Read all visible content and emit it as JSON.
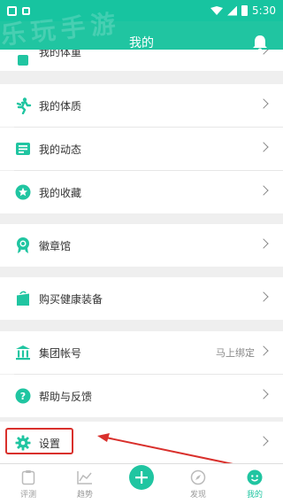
{
  "status_bar": {
    "time": "5:30"
  },
  "header": {
    "title": "我的",
    "watermark": "乐玩手游"
  },
  "menu": {
    "partial_item": "我的体重",
    "physique": "我的体质",
    "posts": "我的动态",
    "favorites": "我的收藏",
    "badges": "徽章馆",
    "buy_gear": "购买健康装备",
    "group_account": "集团帐号",
    "group_account_value": "马上绑定",
    "help": "帮助与反馈",
    "settings": "设置"
  },
  "tabbar": {
    "tabs": [
      {
        "label": "评测"
      },
      {
        "label": "趋势"
      },
      {
        "label": ""
      },
      {
        "label": "发现"
      },
      {
        "label": "我的"
      }
    ]
  },
  "colors": {
    "accent": "#20c5a1",
    "annotation": "#d9302c"
  }
}
